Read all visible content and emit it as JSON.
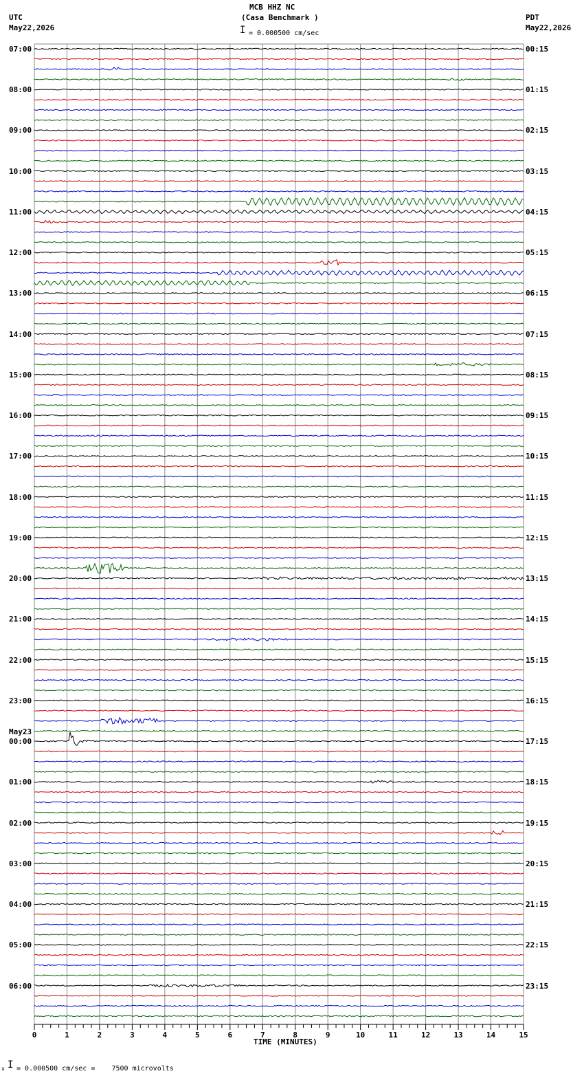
{
  "header": {
    "station": "MCB HHZ NC",
    "site": "(Casa Benchmark )",
    "scale_text": "= 0.000500 cm/sec",
    "left_zone": "UTC",
    "left_date": "May22,2026",
    "right_zone": "PDT",
    "right_date": "May22,2026"
  },
  "footer": {
    "scale_text": "= 0.000500 cm/sec =    7500 microvolts",
    "mark": "x"
  },
  "colors": {
    "trace_cycle": [
      "#000000",
      "#cc0000",
      "#0000cc",
      "#006600"
    ],
    "grid": "#888888"
  },
  "chart_data": {
    "type": "line",
    "xlabel": "TIME (MINUTES)",
    "xlim": [
      0,
      15
    ],
    "x_ticks": [
      "0",
      "1",
      "2",
      "3",
      "4",
      "5",
      "6",
      "7",
      "8",
      "9",
      "10",
      "11",
      "12",
      "13",
      "14",
      "15"
    ],
    "trace_count": 96,
    "left_labels": [
      "07:00",
      "08:00",
      "09:00",
      "10:00",
      "11:00",
      "12:00",
      "13:00",
      "14:00",
      "15:00",
      "16:00",
      "17:00",
      "18:00",
      "19:00",
      "20:00",
      "21:00",
      "22:00",
      "23:00",
      "00:00",
      "01:00",
      "02:00",
      "03:00",
      "04:00",
      "05:00",
      "06:00"
    ],
    "date_change_label": "May23",
    "date_change_row": 68,
    "right_labels": [
      "00:15",
      "01:15",
      "02:15",
      "03:15",
      "04:15",
      "05:15",
      "06:15",
      "07:15",
      "08:15",
      "09:15",
      "10:15",
      "11:15",
      "12:15",
      "13:15",
      "14:15",
      "15:15",
      "16:15",
      "17:15",
      "18:15",
      "19:15",
      "20:15",
      "21:15",
      "22:15",
      "23:15"
    ],
    "events": [
      {
        "row": 2,
        "start_min": 2.2,
        "end_min": 2.6,
        "amp": 2
      },
      {
        "row": 3,
        "start_min": 12.7,
        "end_min": 13.2,
        "amp": 2
      },
      {
        "row": 15,
        "start_min": 6.5,
        "end_min": 15.0,
        "amp": 5,
        "kind": "wave"
      },
      {
        "row": 16,
        "start_min": 0.0,
        "end_min": 15.0,
        "amp": 2,
        "kind": "wave"
      },
      {
        "row": 17,
        "start_min": 0.0,
        "end_min": 0.8,
        "amp": 2
      },
      {
        "row": 21,
        "start_min": 8.8,
        "end_min": 9.6,
        "amp": 4
      },
      {
        "row": 22,
        "start_min": 5.6,
        "end_min": 15.0,
        "amp": 3,
        "kind": "wave"
      },
      {
        "row": 23,
        "start_min": 0.0,
        "end_min": 6.6,
        "amp": 3,
        "kind": "wave"
      },
      {
        "row": 31,
        "start_min": 12.3,
        "end_min": 14.0,
        "amp": 2
      },
      {
        "row": 51,
        "start_min": 1.6,
        "end_min": 2.9,
        "amp": 7
      },
      {
        "row": 52,
        "start_min": 7.0,
        "end_min": 15.0,
        "amp": 1.5
      },
      {
        "row": 58,
        "start_min": 5.2,
        "end_min": 7.9,
        "amp": 1.5
      },
      {
        "row": 66,
        "start_min": 2.0,
        "end_min": 3.8,
        "amp": 4
      },
      {
        "row": 68,
        "start_min": 1.05,
        "end_min": 2.0,
        "amp": 18,
        "kind": "quake"
      },
      {
        "row": 72,
        "start_min": 10.2,
        "end_min": 11.0,
        "amp": 2
      },
      {
        "row": 77,
        "start_min": 13.8,
        "end_min": 14.4,
        "amp": 3
      },
      {
        "row": 92,
        "start_min": 3.5,
        "end_min": 6.3,
        "amp": 1.5
      }
    ]
  }
}
